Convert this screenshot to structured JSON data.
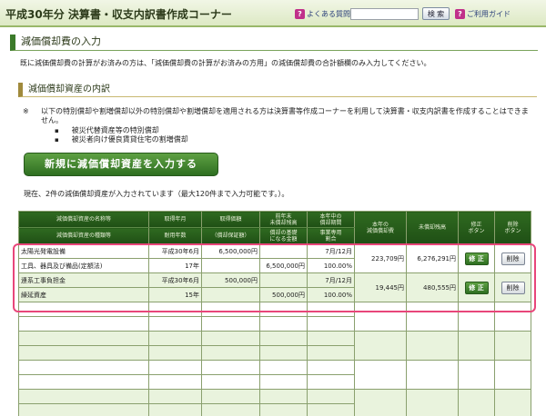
{
  "header": {
    "title": "平成30年分 決算書・収支内訳書作成コーナー",
    "faq_label": "よくある質問",
    "faq_icon": "?",
    "search_placeholder": "",
    "search_button": "検 索",
    "guide_label": "ご利用ガイド",
    "guide_icon": "?"
  },
  "section": {
    "title": "減価償却費の入力",
    "intro": "既に減価償却費の計算がお済みの方は、「減価償却費の計算がお済みの方用」の減価償却費の合計額欄のみ入力してください。"
  },
  "subsection": {
    "title": "減価償却資産の内訳",
    "note_mark": "※",
    "note": "以下の特別償却や割増償却以外の特別償却や割増償却を適用される方は決算書等作成コーナーを利用して決算書・収支内訳書を作成することはできません。",
    "bullets": [
      {
        "dot": "▪",
        "text": "被災代替資産等の特別償却"
      },
      {
        "dot": "▪",
        "text": "被災者向け優良賃貸住宅の割増償却"
      }
    ]
  },
  "new_asset_button": "新規に減価償却資産を入力する",
  "status": "現在、2件の減価償却資産が入力されています（最大120件まで入力可能です。）。",
  "table": {
    "headers_top": [
      "減価償却資産の名称等",
      "取得年月",
      "取得価額",
      "前年末\n未償却残高",
      "本年中の\n償却期間",
      "本年の\n減価償却費",
      "未償却残高",
      "修正\nボタン",
      "削除\nボタン"
    ],
    "headers_bottom": [
      "減価償却資産の種類等",
      "耐用年数",
      "（償却保証額）",
      "償却の基礎\nになる金額",
      "事業専用\n割合"
    ],
    "rows": [
      {
        "name": "太陽光発電設備",
        "acquired": "平成30年6月",
        "price": "6,500,000円",
        "prev_balance": "",
        "period": "7月/12月",
        "category": "工具、器具及び備品(定額法)",
        "life": "17年",
        "guarantee": "",
        "basis": "6,500,000円",
        "ratio": "100.00%",
        "depreciation": "223,709円",
        "remaining": "6,276,291円",
        "edit": "修 正",
        "delete": "削除"
      },
      {
        "name": "連系工事負担金",
        "acquired": "平成30年6月",
        "price": "500,000円",
        "prev_balance": "",
        "period": "7月/12月",
        "category": "繰延資産",
        "life": "15年",
        "guarantee": "",
        "basis": "500,000円",
        "ratio": "100.00%",
        "depreciation": "19,445円",
        "remaining": "480,555円",
        "edit": "修 正",
        "delete": "削除"
      }
    ]
  }
}
